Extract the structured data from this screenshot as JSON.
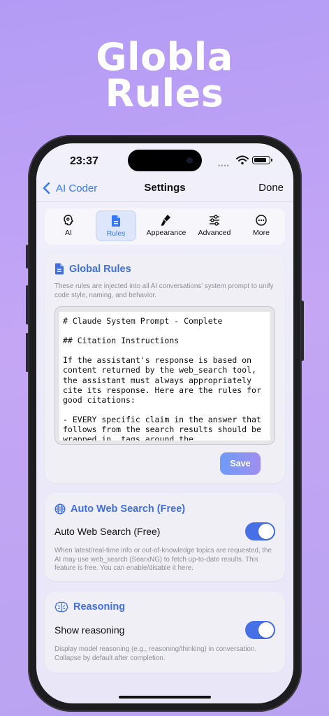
{
  "hero": {
    "line1": "Globla",
    "line2": "Rules"
  },
  "status_bar": {
    "time": "23:37",
    "signal_dots": "••••"
  },
  "nav": {
    "back_label": "AI Coder",
    "title": "Settings",
    "done_label": "Done"
  },
  "tabs": [
    {
      "label": "AI",
      "icon": "brain-icon",
      "active": false
    },
    {
      "label": "Rules",
      "icon": "document-icon",
      "active": true
    },
    {
      "label": "Appearance",
      "icon": "paintbrush-icon",
      "active": false
    },
    {
      "label": "Advanced",
      "icon": "sliders-icon",
      "active": false
    },
    {
      "label": "More",
      "icon": "ellipsis-circle-icon",
      "active": false
    }
  ],
  "global_rules": {
    "title": "Global Rules",
    "description": "These rules are injected into all AI conversations' system prompt to unify code style, naming, and behavior.",
    "editor_text": "# Claude System Prompt - Complete\n\n## Citation Instructions\n\nIf the assistant's response is based on content returned by the web_search tool, the assistant must always appropriately cite its response. Here are the rules for good citations:\n\n- EVERY specific claim in the answer that follows from the search results should be wrapped in  tags around the",
    "save_label": "Save"
  },
  "auto_web_search": {
    "title": "Auto Web Search (Free)",
    "toggle_label": "Auto Web Search (Free)",
    "enabled": true,
    "description": "When latest/real-time info or out-of-knowledge topics are requested, the AI may use web_search (SearxNG) to fetch up-to-date results. This feature is free. You can enable/disable it here."
  },
  "reasoning": {
    "title": "Reasoning",
    "toggle_label": "Show reasoning",
    "enabled": true,
    "description": "Display model reasoning (e.g., reasoning/thinking) in conversation. Collapse by default after completion."
  },
  "colors": {
    "accent": "#3478f6",
    "section_title": "#3f6fe0",
    "toggle_on": "#4670e6",
    "background_top": "#b39bf5"
  }
}
